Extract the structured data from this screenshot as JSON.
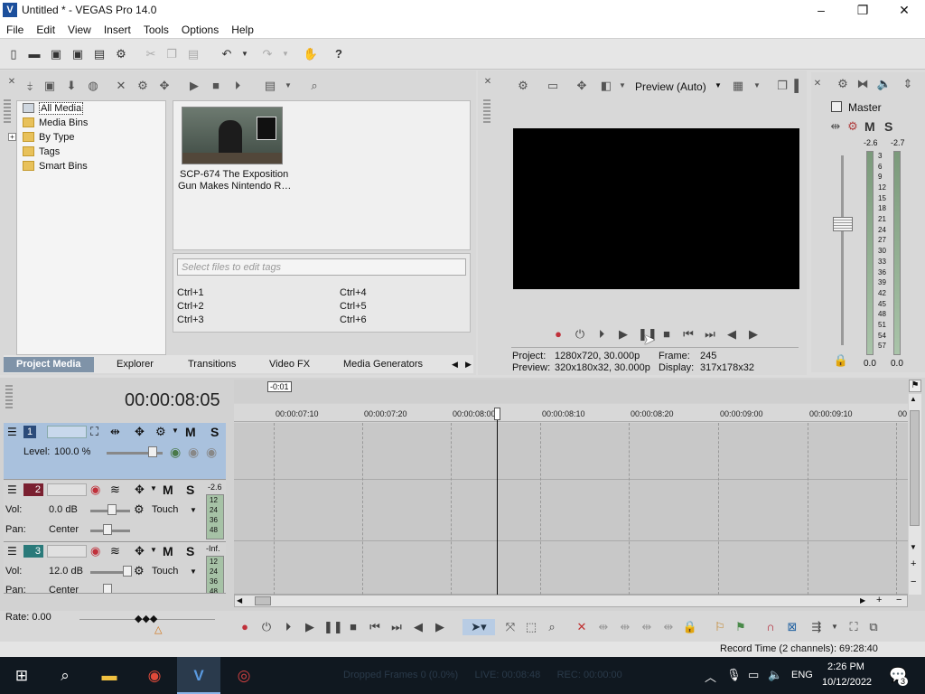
{
  "window": {
    "title": "Untitled * - VEGAS Pro 14.0"
  },
  "menu": [
    "File",
    "Edit",
    "View",
    "Insert",
    "Tools",
    "Options",
    "Help"
  ],
  "media_panel": {
    "tree": [
      "All Media",
      "Media Bins",
      "By Type",
      "Tags",
      "Smart Bins"
    ],
    "expand_symbol": "+",
    "item_name_line1": "SCP-674 The Exposition",
    "item_name_line2": "Gun Makes Nintendo R…",
    "tags_placeholder": "Select files to edit tags",
    "shortcuts": [
      "Ctrl+1",
      "Ctrl+2",
      "Ctrl+3",
      "Ctrl+4",
      "Ctrl+5",
      "Ctrl+6"
    ],
    "tabs": [
      "Project Media",
      "Explorer",
      "Transitions",
      "Video FX",
      "Media Generators"
    ]
  },
  "preview_panel": {
    "mode": "Preview (Auto)",
    "project_label": "Project:",
    "project_value": "1280x720, 30.000p",
    "preview_label": "Preview:",
    "preview_value": "320x180x32, 30.000p",
    "frame_label": "Frame:",
    "frame_value": "245",
    "display_label": "Display:",
    "display_value": "317x178x32"
  },
  "master": {
    "title": "Master",
    "m": "M",
    "s": "S",
    "left_level": "-2.6",
    "right_level": "-2.7",
    "scale": [
      "3",
      "6",
      "9",
      "12",
      "15",
      "18",
      "21",
      "24",
      "27",
      "30",
      "33",
      "36",
      "39",
      "42",
      "45",
      "48",
      "51",
      "54",
      "57"
    ],
    "left_bottom": "0.0",
    "right_bottom": "0.0"
  },
  "timeline": {
    "timecode": "00:00:08:05",
    "marker": "-0:01",
    "ruler": [
      "00:00:07:10",
      "00:00:07:20",
      "00:00:08:00",
      "00:00:08:10",
      "00:00:08:20",
      "00:00:09:00",
      "00:00:09:10",
      "00"
    ],
    "playhead_fraction": 0.39
  },
  "tracks": [
    {
      "number": "1",
      "label1": "Level:",
      "value1": "100.0 %",
      "m": "M",
      "s": "S"
    },
    {
      "number": "2",
      "vol_label": "Vol:",
      "vol": "0.0 dB",
      "pan_label": "Pan:",
      "pan": "Center",
      "mode": "Touch",
      "m": "M",
      "s": "S",
      "peak": "-2.6",
      "scale": [
        "12",
        "24",
        "36",
        "48"
      ]
    },
    {
      "number": "3",
      "vol_label": "Vol:",
      "vol": "12.0 dB",
      "pan_label": "Pan:",
      "pan": "Center",
      "mode": "Touch",
      "m": "M",
      "s": "S",
      "peak": "-Inf.",
      "scale": [
        "12",
        "24",
        "36",
        "48"
      ]
    }
  ],
  "rate": "Rate: 0.00",
  "status": {
    "record_time": "Record Time (2 channels): 69:28:40"
  },
  "taskbar": {
    "ghost_status": "Dropped Frames 0 (0.0%)      LIVE: 00:08:48      REC: 00:00:00",
    "language": "ENG",
    "time": "2:26 PM",
    "date": "10/12/2022",
    "notifications": "3"
  },
  "colors": {
    "selected_tab": "#7f93a8",
    "selected_track": "#a9c1dd",
    "record": "#c0303a",
    "taskbar": "#101820"
  }
}
